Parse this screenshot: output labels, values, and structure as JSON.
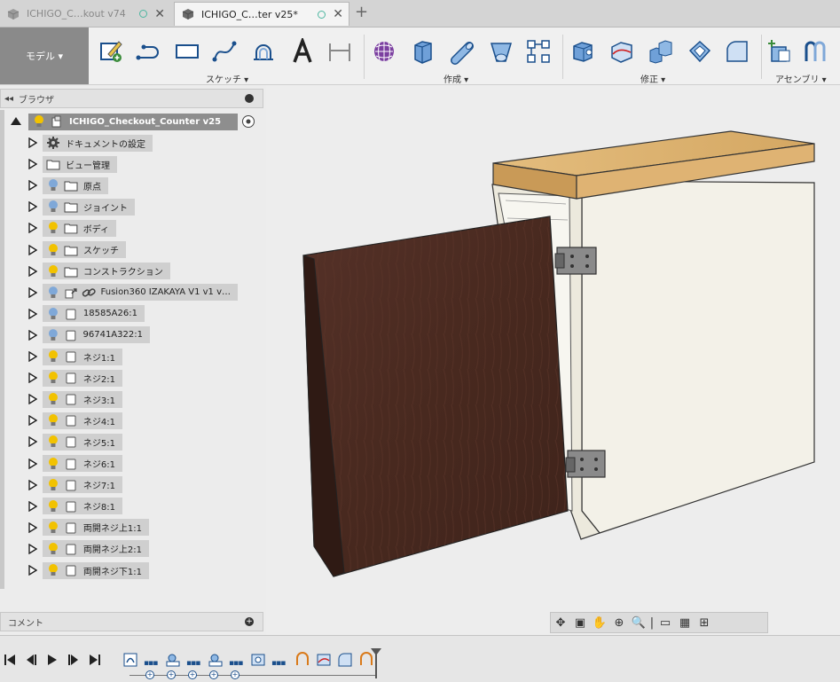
{
  "tabs": [
    {
      "label": "ICHIGO_C…kout v74",
      "active": false
    },
    {
      "label": "ICHIGO_C…ter v25*",
      "active": true
    }
  ],
  "toolbar": {
    "mode": "モデル ▾",
    "groups": [
      {
        "label": "スケッチ ▾"
      },
      {
        "label": "作成 ▾"
      },
      {
        "label": "修正 ▾"
      },
      {
        "label": "アセンブリ ▾"
      }
    ]
  },
  "browser": {
    "title": "ブラウザ",
    "root": "ICHIGO_Checkout_Counter v25",
    "items": [
      {
        "label": "ドキュメントの設定",
        "icon": "gear-icon",
        "bulb": "none"
      },
      {
        "label": "ビュー管理",
        "icon": "folder-icon",
        "bulb": "none"
      },
      {
        "label": "原点",
        "icon": "folder-icon",
        "bulb": "off"
      },
      {
        "label": "ジョイント",
        "icon": "folder-icon",
        "bulb": "off"
      },
      {
        "label": "ボディ",
        "icon": "folder-icon",
        "bulb": "on"
      },
      {
        "label": "スケッチ",
        "icon": "folder-icon",
        "bulb": "on"
      },
      {
        "label": "コンストラクション",
        "icon": "folder-icon",
        "bulb": "on"
      },
      {
        "label": "Fusion360 IZAKAYA V1 v1 v…",
        "icon": "link-icon",
        "bulb": "off"
      },
      {
        "label": "18585A26:1",
        "icon": "component-icon",
        "bulb": "off"
      },
      {
        "label": "96741A322:1",
        "icon": "component-icon",
        "bulb": "off"
      },
      {
        "label": "ネジ1:1",
        "icon": "component-icon",
        "bulb": "on"
      },
      {
        "label": "ネジ2:1",
        "icon": "component-icon",
        "bulb": "on"
      },
      {
        "label": "ネジ3:1",
        "icon": "component-icon",
        "bulb": "on"
      },
      {
        "label": "ネジ4:1",
        "icon": "component-icon",
        "bulb": "on"
      },
      {
        "label": "ネジ5:1",
        "icon": "component-icon",
        "bulb": "on"
      },
      {
        "label": "ネジ6:1",
        "icon": "component-icon",
        "bulb": "on"
      },
      {
        "label": "ネジ7:1",
        "icon": "component-icon",
        "bulb": "on"
      },
      {
        "label": "ネジ8:1",
        "icon": "component-icon",
        "bulb": "on"
      },
      {
        "label": "両開ネジ上1:1",
        "icon": "component-icon",
        "bulb": "on"
      },
      {
        "label": "両開ネジ上2:1",
        "icon": "component-icon",
        "bulb": "on"
      },
      {
        "label": "両開ネジ下1:1",
        "icon": "component-icon",
        "bulb": "on"
      }
    ]
  },
  "comment": {
    "title": "コメント"
  },
  "colors": {
    "accent": "#1a4f8c",
    "bulb_on": "#f2c200",
    "bulb_off": "#7fa8d8",
    "door": "#4a2b22",
    "countertop": "#d8ad6a",
    "cabinet": "#f3f1e8"
  }
}
